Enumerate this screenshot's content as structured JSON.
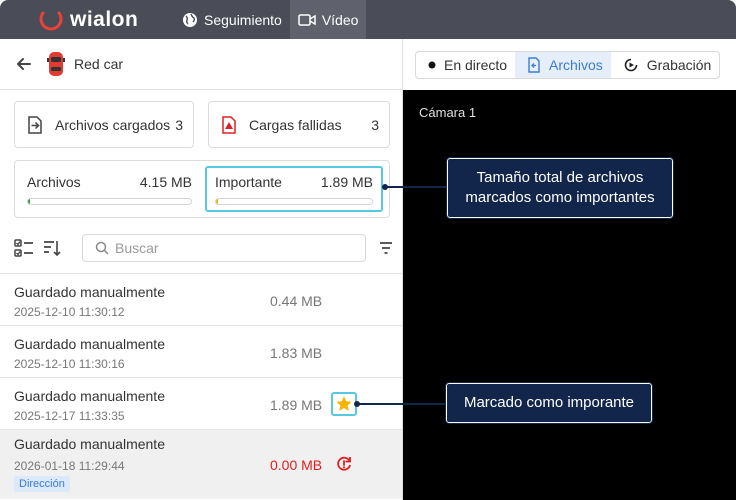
{
  "app": {
    "logo": "wialon"
  },
  "nav": [
    {
      "label": "Seguimiento",
      "icon": "globe-icon"
    },
    {
      "label": "Vídeo",
      "icon": "video-camera-icon",
      "active": true
    }
  ],
  "unit": {
    "name": "Red car",
    "icon": "red-car-icon"
  },
  "uploads": {
    "success": {
      "label": "Archivos cargados",
      "count": "3"
    },
    "failed": {
      "label": "Cargas fallidas",
      "count": "3"
    }
  },
  "storage": {
    "all": {
      "label": "Archivos",
      "size": "4.15 MB",
      "fill_fraction": 0.01,
      "color": "#2e9e3a"
    },
    "important": {
      "label": "Importante",
      "size": "1.89 MB",
      "fill_fraction": 0.01,
      "color": "#e8b800"
    }
  },
  "search": {
    "placeholder": "Buscar",
    "value": ""
  },
  "files": [
    {
      "title": "Guardado manualmente",
      "date": "2025-12-10 11:30:12",
      "size": "0.44 MB"
    },
    {
      "title": "Guardado manualmente",
      "date": "2025-12-10 11:30:16",
      "size": "1.83 MB"
    },
    {
      "title": "Guardado manualmente",
      "date": "2025-12-17 11:33:35",
      "size": "1.89 MB",
      "important": true
    },
    {
      "title": "Guardado manualmente",
      "date": "2026-01-18 11:29:44",
      "size": "0.00 MB",
      "failed": true,
      "tag": "Dirección"
    }
  ],
  "player": {
    "tabs": [
      {
        "label": "En directo",
        "icon": "live-dot-icon"
      },
      {
        "label": "Archivos",
        "icon": "file-upload-icon",
        "active": true
      },
      {
        "label": "Grabación",
        "icon": "record-icon"
      }
    ],
    "camera_label": "Cámara 1"
  },
  "annotations": {
    "important_size": "Tamaño total de archivos marcados como importantes",
    "important_mark": "Marcado como imporante"
  },
  "colors": {
    "accent": "#3a7bd5",
    "highlight": "#58c8e0",
    "callout": "#12254a",
    "error": "#e02020"
  }
}
